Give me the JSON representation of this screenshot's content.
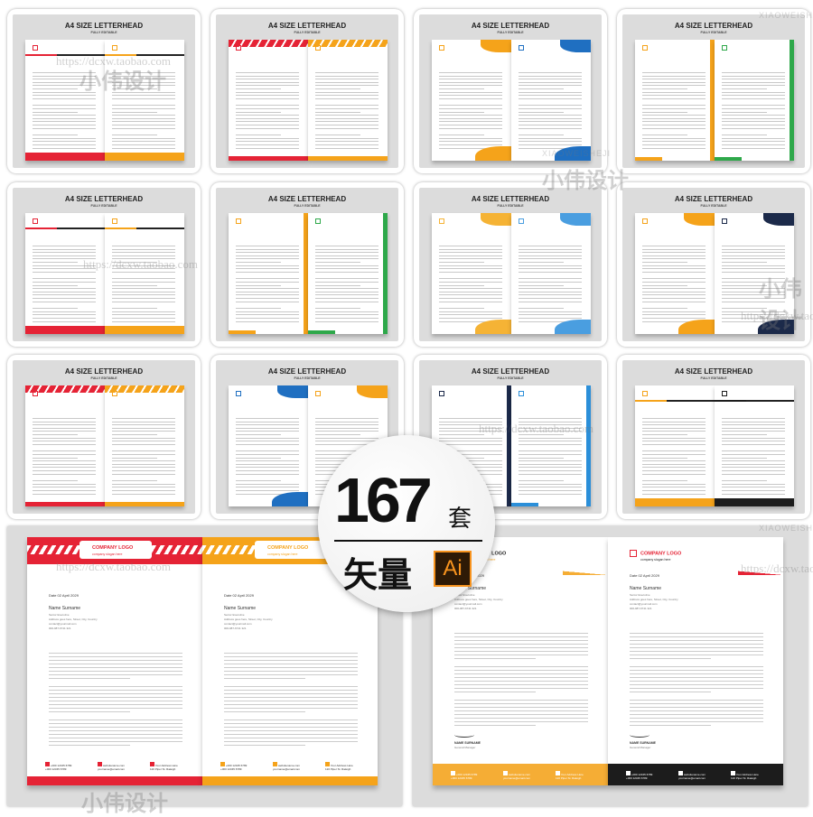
{
  "card_title": "A4 SIZE LETTERHEAD",
  "card_subtitle": "FULLY EDITABLE",
  "cards": [
    {
      "colors": [
        "#e52335",
        "#f5a31a"
      ],
      "style": "footer"
    },
    {
      "colors": [
        "#e52335",
        "#f5a31a"
      ],
      "style": "diagonal"
    },
    {
      "colors": [
        "#f5a31a",
        "#1f6fc1"
      ],
      "style": "wave"
    },
    {
      "colors": [
        "#f5a31a",
        "#2ea84a"
      ],
      "style": "side"
    },
    {
      "colors": [
        "#e52335",
        "#f5a31a"
      ],
      "style": "footer"
    },
    {
      "colors": [
        "#f5a31a",
        "#2ea84a"
      ],
      "style": "side"
    },
    {
      "colors": [
        "#f5b335",
        "#4a9ee0"
      ],
      "style": "wave"
    },
    {
      "colors": [
        "#f5a31a",
        "#1c2a4a"
      ],
      "style": "wave"
    },
    {
      "colors": [
        "#e52335",
        "#f5a31a"
      ],
      "style": "diagonal"
    },
    {
      "colors": [
        "#1f6fc1",
        "#f5a31a"
      ],
      "style": "wave"
    },
    {
      "colors": [
        "#1c2a4a",
        "#2b8fd9"
      ],
      "style": "side"
    },
    {
      "colors": [
        "#f5a31a",
        "#1c1c1c"
      ],
      "style": "footer"
    }
  ],
  "badge": {
    "count": "167",
    "unit": "套",
    "vector": "矢量",
    "ai": "Ai"
  },
  "letter": {
    "company": "COMPANY LOGO",
    "slogan": "company slogan here",
    "date": "Date 02 April 2029",
    "name": "Name Surname",
    "position": "Senior Executive",
    "address": "Address goes here, Street, City, Country",
    "email": "contact@yourmail.com",
    "phone": "000-987-6741 321",
    "sign_name": "NAME SURNAME",
    "sign_title": "General Manager",
    "footer": {
      "phone1": "+000 12345 6789",
      "phone2": "+000 12345 6789",
      "web": "websitename.com",
      "mail": "yourname@email.com",
      "addr1": "Your Address Here",
      "addr2": "120 Piper St. Raleigh"
    }
  },
  "big_panels": [
    {
      "colors": [
        "#e52335",
        "#f5a31a"
      ]
    },
    {
      "colors": [
        "#f5ad35",
        "#1c1c1c"
      ]
    }
  ],
  "watermark": {
    "url": "https://dcxw.taobao.com",
    "latin": "XIAOWEISHEJI",
    "cn": "小伟设计"
  }
}
